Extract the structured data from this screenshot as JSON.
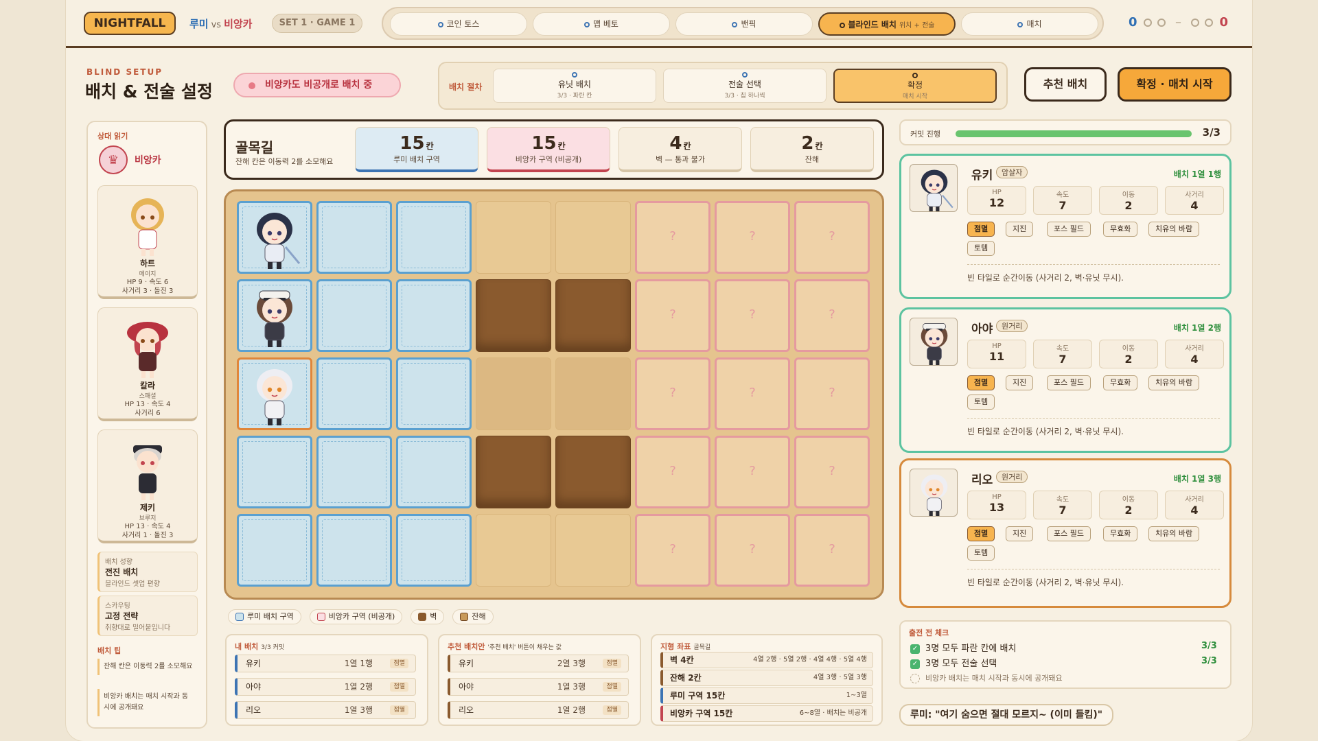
{
  "logo": "NIGHTFALL",
  "matchup": {
    "blue": "루미",
    "vs": "vs",
    "pink": "비앙카"
  },
  "set_label": "SET 1 · GAME 1",
  "steps": [
    {
      "label": "코인 토스"
    },
    {
      "label": "맵 베토"
    },
    {
      "label": "밴픽"
    },
    {
      "label": "블라인드 배치",
      "sub": "위치 + 전술"
    },
    {
      "label": "매치"
    }
  ],
  "score": {
    "left": "0",
    "right": "0"
  },
  "header": {
    "eyebrow": "BLIND SETUP",
    "title": "배치 & 전술 설정",
    "hidden_notice": "비앙카도 비공개로 배치 중",
    "proc_label": "배치 절차",
    "proc_steps": [
      {
        "title": "유닛 배치",
        "sub": "3/3 · 파란 칸"
      },
      {
        "title": "전술 선택",
        "sub": "3/3 · 칩 하나씩"
      },
      {
        "title": "확정",
        "sub": "매치 시작"
      }
    ],
    "btn_recommend": "추천 배치",
    "btn_confirm": "확정 · 매치 시작"
  },
  "left": {
    "read_label": "상대 읽기",
    "opponent": "비앙카",
    "cards": [
      {
        "name": "하트",
        "class": "메이지",
        "stat1": "HP 9 · 속도 6",
        "stat2": "사거리 3 · 돌진 3"
      },
      {
        "name": "칼라",
        "class": "스패셜",
        "stat1": "HP 13 · 속도 4",
        "stat2": "사거리 6"
      },
      {
        "name": "제키",
        "class": "브루저",
        "stat1": "HP 13 · 속도 4",
        "stat2": "사거리 1 · 돌진 3"
      }
    ],
    "tendency": {
      "label": "배치 성향",
      "value": "전진 배치",
      "note": "블라인드 셋업 편향"
    },
    "scouting": {
      "label": "스카우팅",
      "value": "고정 전략",
      "note": "취향대로 밀어붙입니다"
    },
    "tips_label": "배치 팁",
    "tips": [
      "잔해 칸은 이동력 2를 소모해요",
      "비앙카 배치는 매치 시작과 동시에 공개돼요"
    ]
  },
  "terrain": {
    "name": "골목길",
    "desc": "잔해 칸은 이동력 2를 소모해요",
    "unit": "칸",
    "stats": [
      {
        "value": "15",
        "label": "루미 배치 구역"
      },
      {
        "value": "15",
        "label": "비앙카 구역 (비공개)"
      },
      {
        "value": "4",
        "label": "벽 — 통과 불가"
      },
      {
        "value": "2",
        "label": "잔해"
      }
    ]
  },
  "board": {
    "hidden_mark": "?"
  },
  "legend": [
    "루미 배치 구역",
    "비앙카 구역 (비공개)",
    "벽",
    "잔해"
  ],
  "my_deploy": {
    "title": "내 배치",
    "sub": "3/3 커밋",
    "rows": [
      {
        "name": "유키",
        "pos": "1열 1행",
        "tag": "점멸"
      },
      {
        "name": "아야",
        "pos": "1열 2행",
        "tag": "점멸"
      },
      {
        "name": "리오",
        "pos": "1열 3행",
        "tag": "점멸"
      }
    ]
  },
  "recommended": {
    "title": "추천 배치안",
    "sub": "'추천 배치' 버튼이 채우는 값",
    "rows": [
      {
        "name": "유키",
        "pos": "2열 3행",
        "tag": "점멸"
      },
      {
        "name": "아야",
        "pos": "1열 3행",
        "tag": "점멸"
      },
      {
        "name": "리오",
        "pos": "1열 2행",
        "tag": "점멸"
      }
    ]
  },
  "coords": {
    "title": "지형 좌표",
    "sub": "골목길",
    "rows": [
      {
        "name": "벽 4칸",
        "value": "4열 2행 · 5열 2행 · 4열 4행 · 5열 4행"
      },
      {
        "name": "잔해 2칸",
        "value": "4열 3행 · 5열 3행"
      },
      {
        "name": "루미 구역 15칸",
        "value": "1~3열"
      },
      {
        "name": "비앙카 구역 15칸",
        "value": "6~8열 · 배치는 비공개"
      }
    ]
  },
  "progress": {
    "label": "커밋 진행",
    "value": "3/3",
    "fraction": 1.0
  },
  "units": [
    {
      "name": "유키",
      "class": "암살자",
      "pos": "배치 1열 1행",
      "hp": "12",
      "spd": "7",
      "move": "2",
      "range": "4",
      "tags": [
        "점멸",
        "지진",
        "포스 필드",
        "무효화",
        "치유의 바람",
        "토템"
      ],
      "desc": "빈 타일로 순간이동 (사거리 2, 벽·유닛 무시)."
    },
    {
      "name": "아야",
      "class": "원거리",
      "pos": "배치 1열 2행",
      "hp": "11",
      "spd": "7",
      "move": "2",
      "range": "4",
      "tags": [
        "점멸",
        "지진",
        "포스 필드",
        "무효화",
        "치유의 바람",
        "토템"
      ],
      "desc": "빈 타일로 순간이동 (사거리 2, 벽·유닛 무시)."
    },
    {
      "name": "리오",
      "class": "원거리",
      "pos": "배치 1열 3행",
      "hp": "13",
      "spd": "7",
      "move": "2",
      "range": "4",
      "tags": [
        "점멸",
        "지진",
        "포스 필드",
        "무효화",
        "치유의 바람",
        "토템"
      ],
      "desc": "빈 타일로 순간이동 (사거리 2, 벽·유닛 무시)."
    }
  ],
  "stat_labels": {
    "hp": "HP",
    "spd": "속도",
    "move": "이동",
    "range": "사거리"
  },
  "checklist": {
    "title": "출전 전 체크",
    "items": [
      {
        "text": "3명 모두 파란 칸에 배치",
        "value": "3/3"
      },
      {
        "text": "3명 모두 전술 선택",
        "value": "3/3"
      },
      {
        "text": "비앙카 배치는 매치 시작과 동시에 공개돼요",
        "value": ""
      }
    ]
  },
  "quote": "루미: \"여기 숨으면 절대 모르지~ (이미 들킴)\""
}
